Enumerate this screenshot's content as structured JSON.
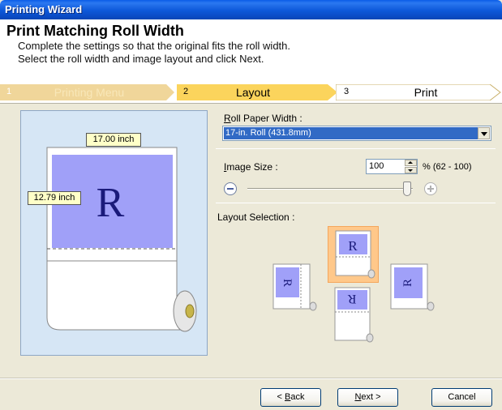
{
  "window": {
    "title": "Printing Wizard"
  },
  "header": {
    "title": "Print Matching Roll Width",
    "line1": "Complete the settings so that the original fits the roll width.",
    "line2": "Select the roll width and image layout and click Next."
  },
  "steps": [
    {
      "num": "1",
      "label": "Printing Menu",
      "state": "done"
    },
    {
      "num": "2",
      "label": "Layout",
      "state": "active"
    },
    {
      "num": "3",
      "label": "Print",
      "state": "upcoming"
    }
  ],
  "preview": {
    "width_label": "17.00 inch",
    "height_label": "12.79 inch",
    "glyph": "R",
    "image_color": "#a0a0f8"
  },
  "roll_paper": {
    "label_mnemonic": "R",
    "label_rest": "oll Paper Width :",
    "value": "17-in. Roll (431.8mm)"
  },
  "image_size": {
    "label_mnemonic": "I",
    "label_rest": "mage Size :",
    "value": "100",
    "range": "% (62 - 100)",
    "slider_fraction": 1.0
  },
  "layout": {
    "label": "Layout Selection :",
    "options": [
      {
        "name": "top",
        "glyph": "R",
        "selected": true
      },
      {
        "name": "left",
        "glyph": "R",
        "selected": false
      },
      {
        "name": "right",
        "glyph": "R",
        "selected": false
      },
      {
        "name": "bottom",
        "glyph": "R",
        "selected": false
      }
    ]
  },
  "buttons": {
    "back_prefix": "< ",
    "back_mnemonic": "B",
    "back_rest": "ack",
    "next_mnemonic": "N",
    "next_rest": "ext >",
    "cancel": "Cancel"
  },
  "colors": {
    "accent": "#316ac5",
    "step_active": "#fbd45c",
    "selected_thumb": "#ffc88a",
    "preview_bg": "#d6e6f5"
  }
}
